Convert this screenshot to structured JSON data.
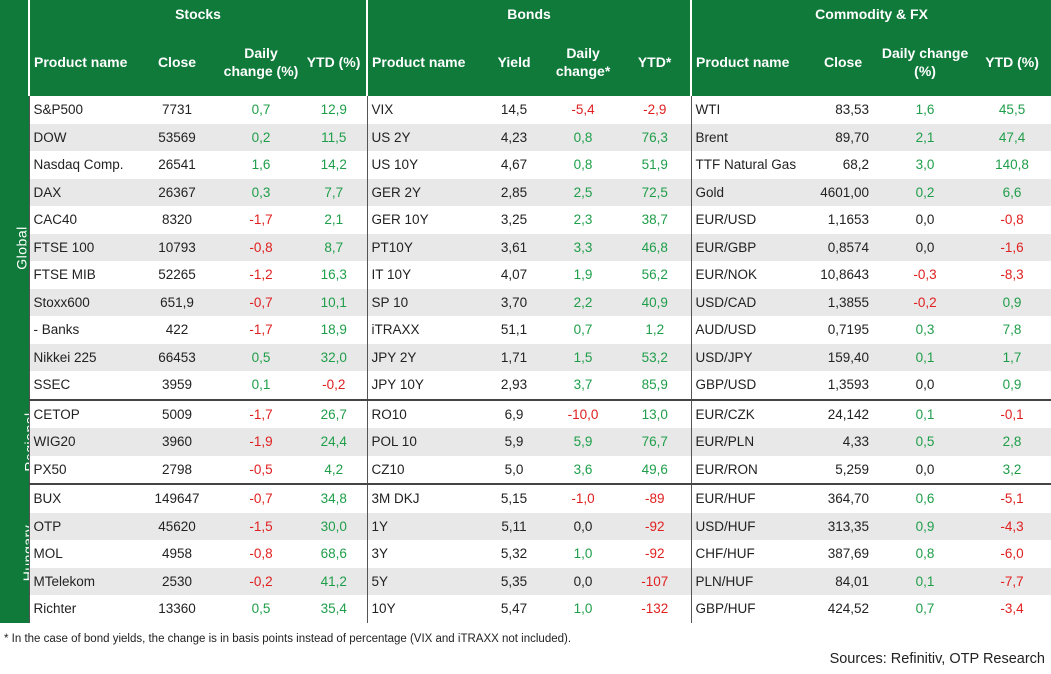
{
  "sections": {
    "stocks": "Stocks",
    "bonds": "Bonds",
    "commodity_fx": "Commodity & FX"
  },
  "headers": {
    "stocks": [
      "Product name",
      "Close",
      "Daily\nchange (%)",
      "YTD (%)"
    ],
    "bonds": [
      "Product name",
      "Yield",
      "Daily\nchange*",
      "YTD*"
    ],
    "commodity_fx": [
      "Product name",
      "Close",
      "Daily change\n(%)",
      "YTD (%)"
    ]
  },
  "groups": [
    {
      "label": "Global",
      "rows": [
        [
          [
            "S&P500",
            "7731",
            "0,7",
            "12,9"
          ],
          [
            "VIX",
            "14,5",
            "-5,4",
            "-2,9"
          ],
          [
            "WTI",
            "83,53",
            "1,6",
            "45,5"
          ]
        ],
        [
          [
            "DOW",
            "53569",
            "0,2",
            "11,5"
          ],
          [
            "US 2Y",
            "4,23",
            "0,8",
            "76,3"
          ],
          [
            "Brent",
            "89,70",
            "2,1",
            "47,4"
          ]
        ],
        [
          [
            "Nasdaq Comp.",
            "26541",
            "1,6",
            "14,2"
          ],
          [
            "US 10Y",
            "4,67",
            "0,8",
            "51,9"
          ],
          [
            "TTF Natural Gas",
            "68,2",
            "3,0",
            "140,8"
          ]
        ],
        [
          [
            "DAX",
            "26367",
            "0,3",
            "7,7"
          ],
          [
            "GER 2Y",
            "2,85",
            "2,5",
            "72,5"
          ],
          [
            "Gold",
            "4601,00",
            "0,2",
            "6,6"
          ]
        ],
        [
          [
            "CAC40",
            "8320",
            "-1,7",
            "2,1"
          ],
          [
            "GER 10Y",
            "3,25",
            "2,3",
            "38,7"
          ],
          [
            "EUR/USD",
            "1,1653",
            "0,0",
            "-0,8"
          ]
        ],
        [
          [
            "FTSE 100",
            "10793",
            "-0,8",
            "8,7"
          ],
          [
            "PT10Y",
            "3,61",
            "3,3",
            "46,8"
          ],
          [
            "EUR/GBP",
            "0,8574",
            "0,0",
            "-1,6"
          ]
        ],
        [
          [
            "FTSE MIB",
            "52265",
            "-1,2",
            "16,3"
          ],
          [
            "IT 10Y",
            "4,07",
            "1,9",
            "56,2"
          ],
          [
            "EUR/NOK",
            "10,8643",
            "-0,3",
            "-8,3"
          ]
        ],
        [
          [
            "Stoxx600",
            "651,9",
            "-0,7",
            "10,1"
          ],
          [
            "SP 10",
            "3,70",
            "2,2",
            "40,9"
          ],
          [
            "USD/CAD",
            "1,3855",
            "-0,2",
            "0,9"
          ]
        ],
        [
          [
            "  - Banks",
            "422",
            "-1,7",
            "18,9"
          ],
          [
            "iTRAXX",
            "51,1",
            "0,7",
            "1,2"
          ],
          [
            "AUD/USD",
            "0,7195",
            "0,3",
            "7,8"
          ]
        ],
        [
          [
            "Nikkei 225",
            "66453",
            "0,5",
            "32,0"
          ],
          [
            "JPY 2Y",
            "1,71",
            "1,5",
            "53,2"
          ],
          [
            "USD/JPY",
            "159,40",
            "0,1",
            "1,7"
          ]
        ],
        [
          [
            "SSEC",
            "3959",
            "0,1",
            "-0,2"
          ],
          [
            "JPY 10Y",
            "2,93",
            "3,7",
            "85,9"
          ],
          [
            "GBP/USD",
            "1,3593",
            "0,0",
            "0,9"
          ]
        ]
      ]
    },
    {
      "label": "Regional",
      "rows": [
        [
          [
            "CETOP",
            "5009",
            "-1,7",
            "26,7"
          ],
          [
            "RO10",
            "6,9",
            "-10,0",
            "13,0"
          ],
          [
            "EUR/CZK",
            "24,142",
            "0,1",
            "-0,1"
          ]
        ],
        [
          [
            "WIG20",
            "3960",
            "-1,9",
            "24,4"
          ],
          [
            "POL 10",
            "5,9",
            "5,9",
            "76,7"
          ],
          [
            "EUR/PLN",
            "4,33",
            "0,5",
            "2,8"
          ]
        ],
        [
          [
            "PX50",
            "2798",
            "-0,5",
            "4,2"
          ],
          [
            "CZ10",
            "5,0",
            "3,6",
            "49,6"
          ],
          [
            "EUR/RON",
            "5,259",
            "0,0",
            "3,2"
          ]
        ]
      ]
    },
    {
      "label": "Hungary",
      "rows": [
        [
          [
            "BUX",
            "149647",
            "-0,7",
            "34,8"
          ],
          [
            "3M DKJ",
            "5,15",
            "-1,0",
            "-89"
          ],
          [
            "EUR/HUF",
            "364,70",
            "0,6",
            "-5,1"
          ]
        ],
        [
          [
            "OTP",
            "45620",
            "-1,5",
            "30,0"
          ],
          [
            "1Y",
            "5,11",
            "0,0",
            "-92"
          ],
          [
            "USD/HUF",
            "313,35",
            "0,9",
            "-4,3"
          ]
        ],
        [
          [
            "MOL",
            "4958",
            "-0,8",
            "68,6"
          ],
          [
            "3Y",
            "5,32",
            "1,0",
            "-92"
          ],
          [
            "CHF/HUF",
            "387,69",
            "0,8",
            "-6,0"
          ]
        ],
        [
          [
            "MTelekom",
            "2530",
            "-0,2",
            "41,2"
          ],
          [
            "5Y",
            "5,35",
            "0,0",
            "-107"
          ],
          [
            "PLN/HUF",
            "84,01",
            "0,1",
            "-7,7"
          ]
        ],
        [
          [
            "Richter",
            "13360",
            "0,5",
            "35,4"
          ],
          [
            "10Y",
            "5,47",
            "1,0",
            "-132"
          ],
          [
            "GBP/HUF",
            "424,52",
            "0,7",
            "-3,4"
          ]
        ]
      ]
    }
  ],
  "colors": {
    "header_green": "#0f7a3a",
    "positive": "#1f9e4a",
    "negative": "#e02020",
    "stripe": "#e8e8e8"
  },
  "footnote": "* In the case of bond yields, the change is in basis points instead of percentage (VIX and iTRAXX not included).",
  "sources": "Sources: Refinitiv, OTP Research"
}
